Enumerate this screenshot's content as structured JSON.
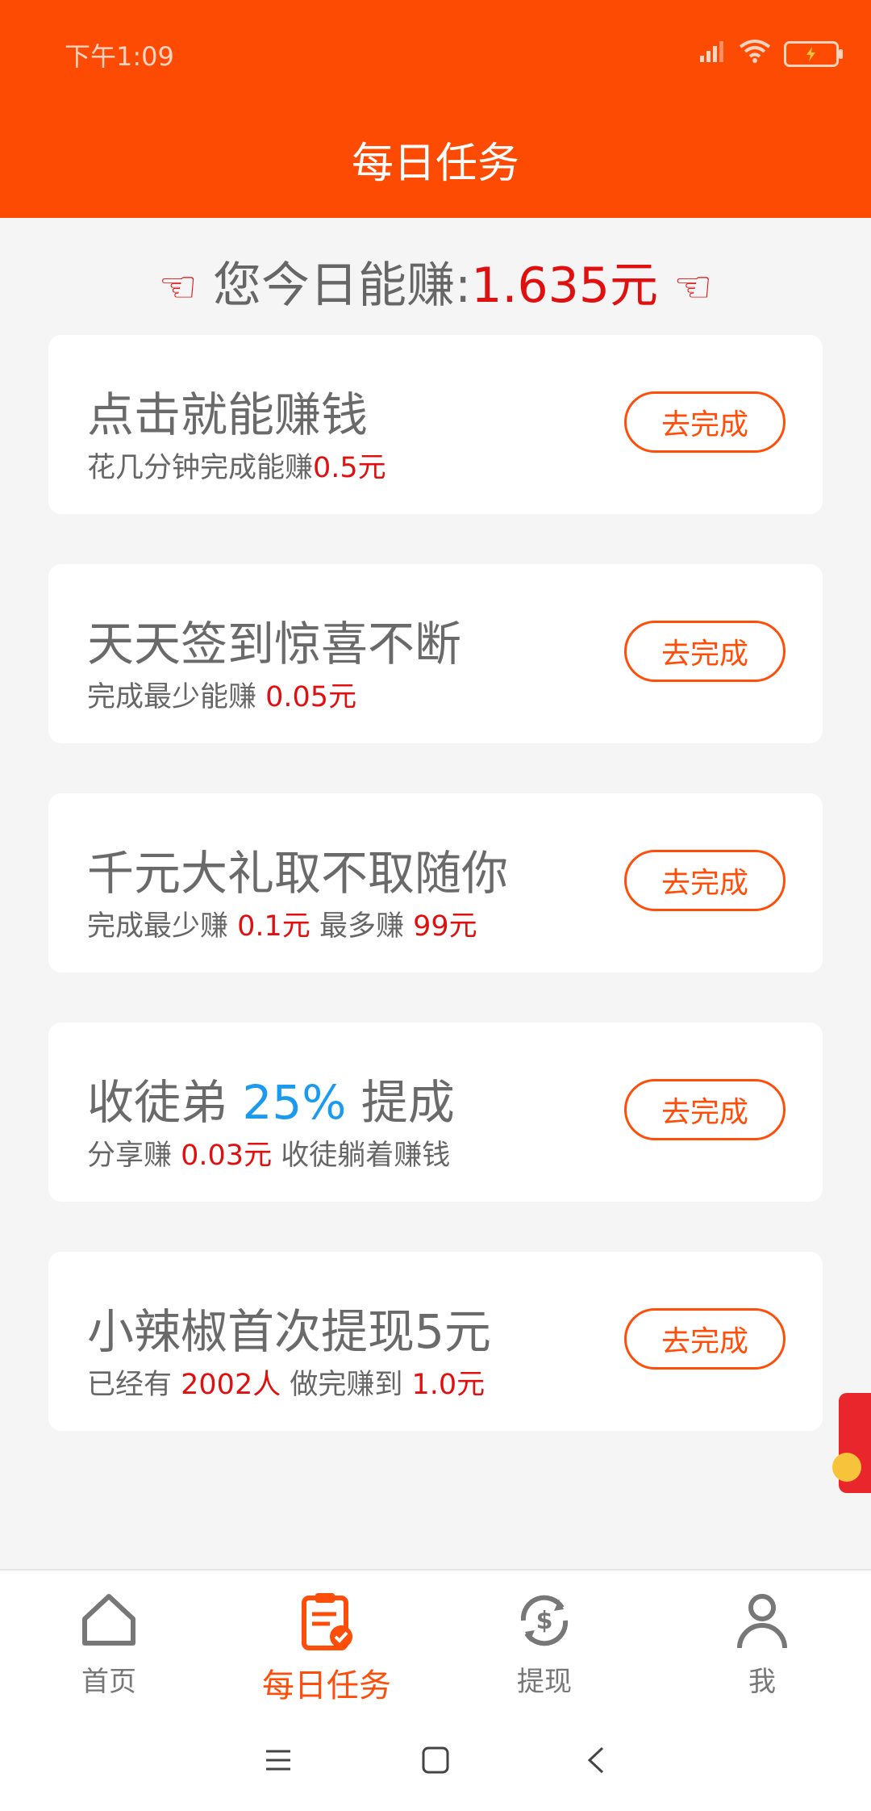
{
  "status": {
    "time": "下午1:09"
  },
  "header": {
    "title": "每日任务"
  },
  "earn": {
    "prefix": "您今日能赚:",
    "amount": "1.635元",
    "hand_left": "☜",
    "hand_right": "☜"
  },
  "tasks": [
    {
      "title": "点击就能赚钱",
      "sub_parts": [
        "花几分钟完成能赚",
        "0.5元"
      ],
      "button": "去完成"
    },
    {
      "title": "天天签到惊喜不断",
      "sub_parts": [
        "完成最少能赚 ",
        "0.05元"
      ],
      "button": "去完成"
    },
    {
      "title": "千元大礼取不取随你",
      "sub_parts": [
        "完成最少赚 ",
        "0.1元",
        " 最多赚 ",
        "99元"
      ],
      "button": "去完成"
    },
    {
      "title_parts": [
        "收徒弟 ",
        "25%",
        " 提成"
      ],
      "sub_parts": [
        "分享赚 ",
        "0.03元",
        " 收徒躺着赚钱"
      ],
      "button": "去完成"
    },
    {
      "title": "小辣椒首次提现5元",
      "sub_parts": [
        "已经有 ",
        "2002人",
        " 做完赚到 ",
        "1.0元"
      ],
      "button": "去完成"
    }
  ],
  "tabs": [
    {
      "label": "首页",
      "icon": "home-icon"
    },
    {
      "label": "每日任务",
      "icon": "clipboard-check-icon",
      "active": true
    },
    {
      "label": "提现",
      "icon": "dollar-exchange-icon"
    },
    {
      "label": "我",
      "icon": "user-icon"
    }
  ],
  "colors": {
    "brand": "#fe4b03",
    "accent_red": "#e01010",
    "accent_blue": "#1b9bf0"
  }
}
